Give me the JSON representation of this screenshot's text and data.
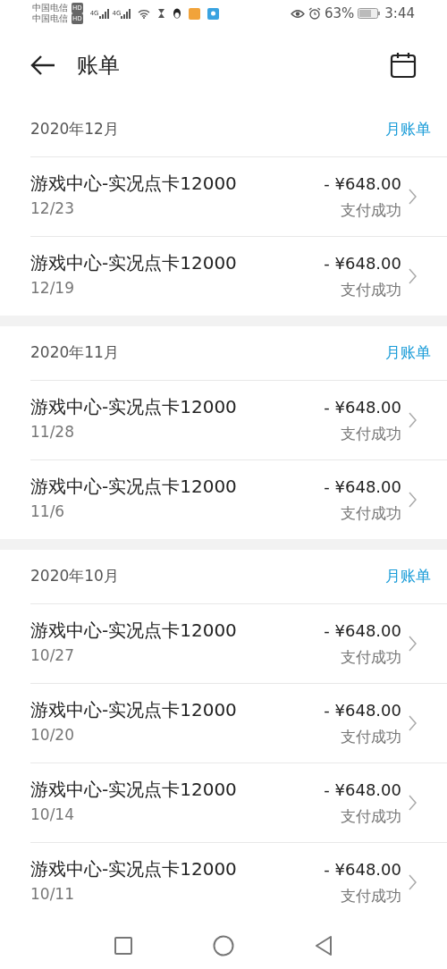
{
  "status_bar": {
    "carriers": [
      {
        "name": "中国电信",
        "badge": "HD"
      },
      {
        "name": "中国电信",
        "badge": "HD"
      }
    ],
    "networks": [
      "4G",
      "4G"
    ],
    "battery": "63%",
    "time": "3:44"
  },
  "header": {
    "title": "账单"
  },
  "sections": [
    {
      "month": "2020年12月",
      "link": "月账单",
      "items": [
        {
          "title": "游戏中心-实况点卡12000",
          "date": "12/23",
          "amount": "- ¥648.00",
          "status": "支付成功"
        },
        {
          "title": "游戏中心-实况点卡12000",
          "date": "12/19",
          "amount": "- ¥648.00",
          "status": "支付成功"
        }
      ]
    },
    {
      "month": "2020年11月",
      "link": "月账单",
      "items": [
        {
          "title": "游戏中心-实况点卡12000",
          "date": "11/28",
          "amount": "- ¥648.00",
          "status": "支付成功"
        },
        {
          "title": "游戏中心-实况点卡12000",
          "date": "11/6",
          "amount": "- ¥648.00",
          "status": "支付成功"
        }
      ]
    },
    {
      "month": "2020年10月",
      "link": "月账单",
      "items": [
        {
          "title": "游戏中心-实况点卡12000",
          "date": "10/27",
          "amount": "- ¥648.00",
          "status": "支付成功"
        },
        {
          "title": "游戏中心-实况点卡12000",
          "date": "10/20",
          "amount": "- ¥648.00",
          "status": "支付成功"
        },
        {
          "title": "游戏中心-实况点卡12000",
          "date": "10/14",
          "amount": "- ¥648.00",
          "status": "支付成功"
        },
        {
          "title": "游戏中心-实况点卡12000",
          "date": "10/11",
          "amount": "- ¥648.00",
          "status": "支付成功"
        }
      ]
    }
  ]
}
